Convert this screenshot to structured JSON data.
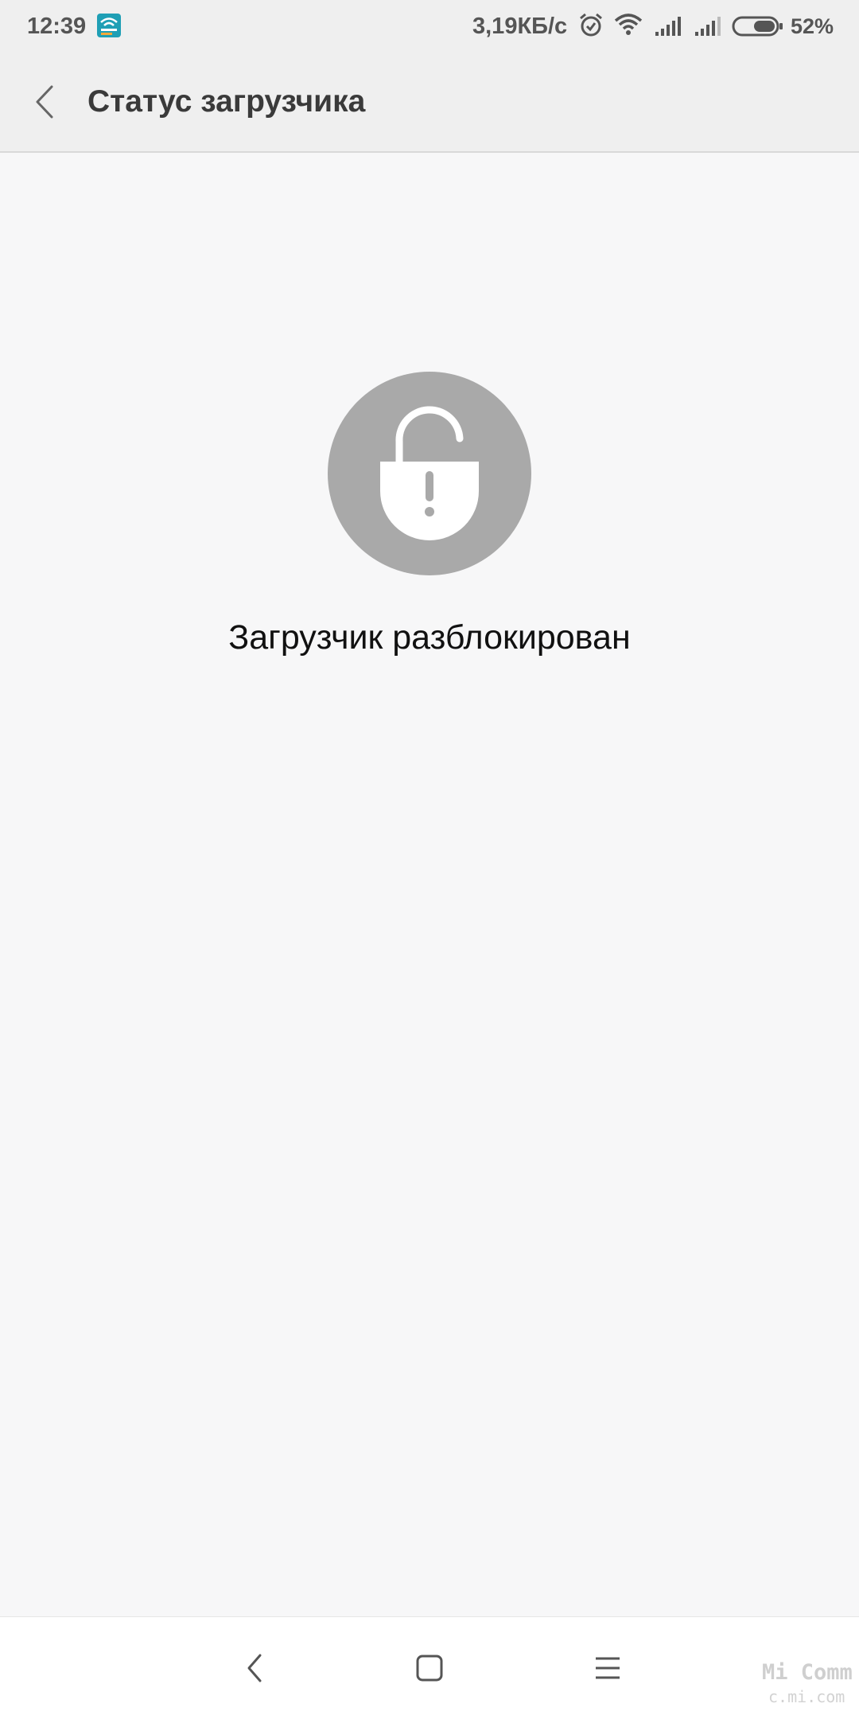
{
  "status_bar": {
    "time": "12:39",
    "notification_icon": "wifi-notes-app-icon",
    "net_speed": "3,19КБ/с",
    "icons": [
      "alarm-icon",
      "wifi-icon",
      "signal-icon",
      "signal-icon",
      "battery-icon"
    ],
    "battery_percent": "52%",
    "battery_level": 0.52
  },
  "header": {
    "title": "Статус загрузчика",
    "back_icon": "chevron-left-icon"
  },
  "main": {
    "lock_icon": "unlocked-padlock-icon",
    "lock_circle_color": "#a9a9a9",
    "message": "Загрузчик разблокирован"
  },
  "nav_bar": {
    "buttons": [
      "back-icon",
      "home-icon",
      "menu-icon"
    ]
  },
  "watermark": {
    "line1": "Mi Comm",
    "line2": "c.mi.com"
  }
}
